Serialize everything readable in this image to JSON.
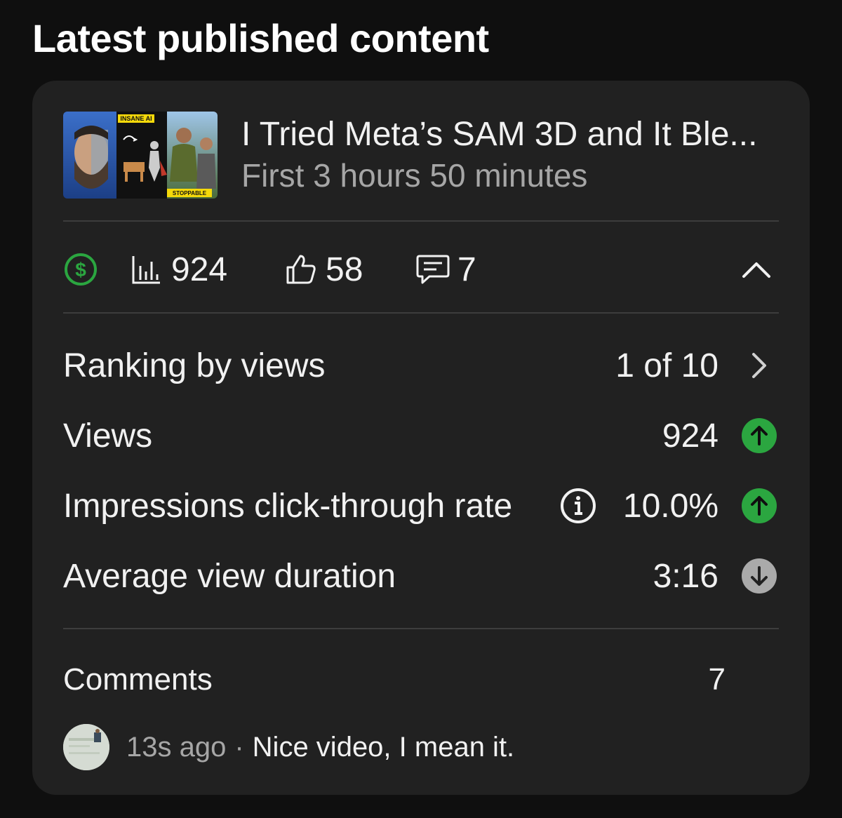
{
  "page": {
    "title": "Latest published content"
  },
  "video": {
    "title": "I Tried Meta’s SAM 3D and It Ble...",
    "subtitle": "First 3 hours 50 minutes",
    "thumbnail": {
      "badge_top": "INSANE AI",
      "badge_bottom": "STOPPABLE"
    }
  },
  "stats": {
    "monetization_icon": "dollar-circle-icon",
    "monetization_color": "#2ba640",
    "views": "924",
    "likes": "58",
    "comments": "7",
    "collapse_icon": "chevron-up-icon"
  },
  "metrics": [
    {
      "label": "Ranking by views",
      "value": "1 of 10",
      "indicator": "chevron-right-icon"
    },
    {
      "label": "Views",
      "value": "924",
      "indicator": "arrow-up-circle-icon",
      "color": "#2ba640"
    },
    {
      "label": "Impressions click-through rate",
      "value": "10.0%",
      "indicator": "arrow-up-circle-icon",
      "color": "#2ba640",
      "info_icon": "info-icon"
    },
    {
      "label": "Average view duration",
      "value": "3:16",
      "indicator": "arrow-down-circle-icon",
      "color": "#aaaaaa"
    }
  ],
  "comments": {
    "label": "Comments",
    "count": "7",
    "latest": {
      "time": "13s ago",
      "separator": "·",
      "text": "Nice video, I mean it."
    }
  }
}
